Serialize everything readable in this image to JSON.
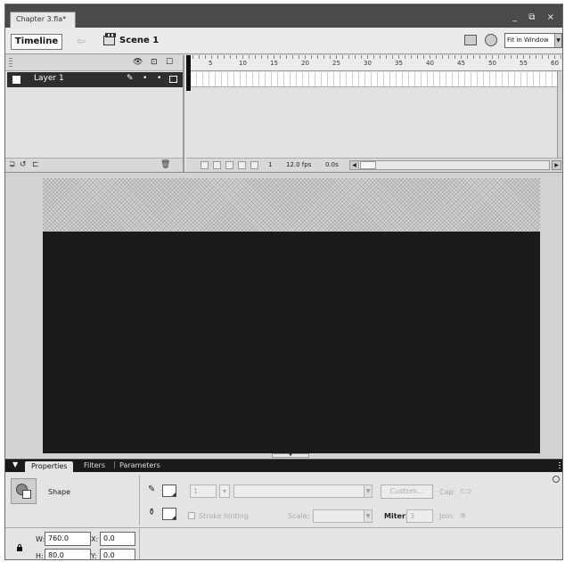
{
  "document": {
    "tab_title": "Chapter 3.fla*",
    "window_controls": "_ ⧉ ×"
  },
  "edit_bar": {
    "timeline_button": "Timeline",
    "scene_label": "Scene 1",
    "zoom_value": "Fit in Window"
  },
  "timeline": {
    "layer_name": "Layer 1",
    "ruler_ticks": [
      "1",
      "5",
      "10",
      "15",
      "20",
      "25",
      "30",
      "35",
      "40",
      "45",
      "50",
      "55",
      "60"
    ],
    "current_frame": "1",
    "frame_rate": "12.0 fps",
    "elapsed_time": "0.0s"
  },
  "properties": {
    "tabs": {
      "properties": "Properties",
      "filters": "Filters",
      "separator": "|",
      "parameters": "Parameters"
    },
    "object_type": "Shape",
    "stroke_height": "1",
    "custom_button": "Custom...",
    "cap_label": "Cap:",
    "stroke_hinting_label": "Stroke hinting",
    "scale_label": "Scale:",
    "miter_label": "Miter:",
    "miter_value": "3",
    "join_label": "Join:",
    "width_label": "W:",
    "width_value": "760.0",
    "height_label": "H:",
    "height_value": "80.0",
    "x_label": "X:",
    "x_value": "0.0",
    "y_label": "Y:",
    "y_value": "0.0"
  },
  "colors": {
    "stage_shape": "#1b1b1b",
    "panel_bg": "#e4e4e4",
    "layer_selected": "#2e2e2e"
  }
}
